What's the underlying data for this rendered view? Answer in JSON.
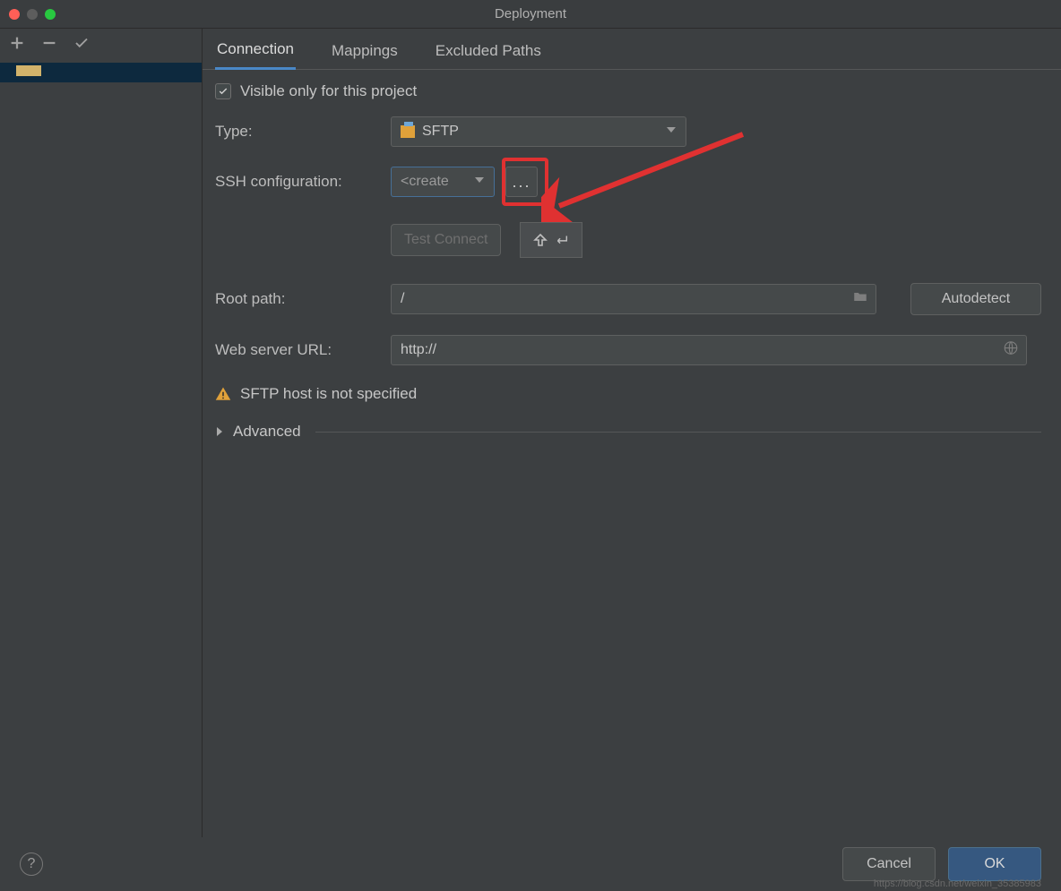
{
  "window": {
    "title": "Deployment"
  },
  "tabs": {
    "connection": "Connection",
    "mappings": "Mappings",
    "excluded": "Excluded Paths"
  },
  "form": {
    "visible_only_label": "Visible only for this project",
    "visible_only_checked": true,
    "type_label": "Type:",
    "type_value": "SFTP",
    "ssh_label": "SSH configuration:",
    "ssh_value": "<create",
    "ellipsis": "...",
    "test_connection": "Test Connect",
    "root_label": "Root path:",
    "root_value": "/",
    "autodetect": "Autodetect",
    "web_url_label": "Web server URL:",
    "web_url_value": "http://",
    "warning": "SFTP host is not specified",
    "advanced": "Advanced"
  },
  "footer": {
    "cancel": "Cancel",
    "ok": "OK",
    "watermark": "https://blog.csdn.net/weixin_35385983"
  }
}
